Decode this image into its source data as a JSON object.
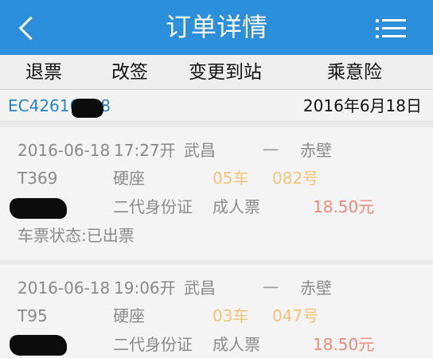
{
  "header": {
    "title": "订单详情"
  },
  "actions": [
    "退票",
    "改签",
    "变更到站",
    "乘意险"
  ],
  "order": {
    "id_prefix": "EC42616",
    "id_suffix": "8",
    "date": "2016年6月18日"
  },
  "tickets": [
    {
      "date": "2016-06-18",
      "time": "17:27开",
      "from": "武昌",
      "sep": "一",
      "to": "赤壁",
      "train": "T369",
      "seat_type": "硬座",
      "car": "05车",
      "seat_no": "082号",
      "id_type": "二代身份证",
      "ticket_type": "成人票",
      "price": "18.50元",
      "status": "车票状态:已出票"
    },
    {
      "date": "2016-06-18",
      "time": "19:06开",
      "from": "武昌",
      "sep": "一",
      "to": "赤壁",
      "train": "T95",
      "seat_type": "硬座",
      "car": "03车",
      "seat_no": "047号",
      "id_type": "二代身份证",
      "ticket_type": "成人票",
      "price": "18.50元"
    }
  ],
  "colors": {
    "header": "#2c8fdc",
    "order_id": "#2a82c8",
    "car_seat": "#f2c47a",
    "price": "#ee8a7a"
  }
}
